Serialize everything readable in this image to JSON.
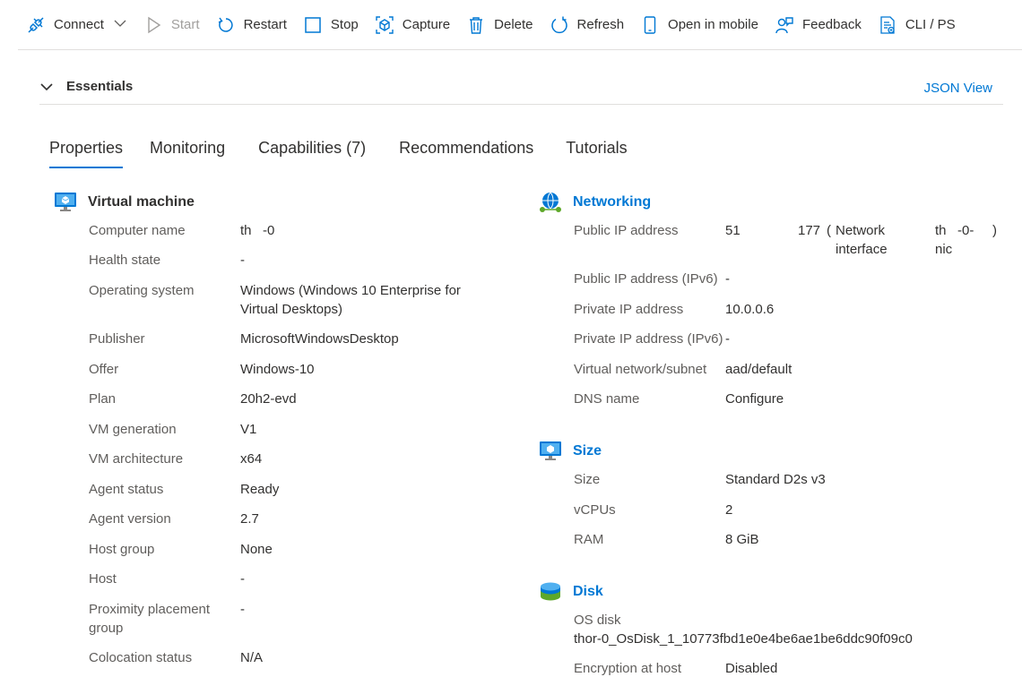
{
  "toolbar": {
    "connect": "Connect",
    "start": "Start",
    "restart": "Restart",
    "stop": "Stop",
    "capture": "Capture",
    "delete": "Delete",
    "refresh": "Refresh",
    "open_in_mobile": "Open in mobile",
    "feedback": "Feedback",
    "cli_ps": "CLI / PS"
  },
  "essentials": {
    "title": "Essentials",
    "json_view": "JSON View"
  },
  "tabs": [
    "Properties",
    "Monitoring",
    "Capabilities (7)",
    "Recommendations",
    "Tutorials"
  ],
  "virtual_machine": {
    "title": "Virtual machine",
    "rows": [
      {
        "label": "Computer name",
        "value": "th   -0"
      },
      {
        "label": "Health state",
        "value": "-"
      },
      {
        "label": "Operating system",
        "value": "Windows (Windows 10 Enterprise for",
        "value2": "Virtual Desktops)"
      },
      {
        "label": "Publisher",
        "value": "MicrosoftWindowsDesktop"
      },
      {
        "label": "Offer",
        "value": "Windows-10"
      },
      {
        "label": "Plan",
        "value": "20h2-evd"
      },
      {
        "label": "VM generation",
        "value": "V1"
      },
      {
        "label": "VM architecture",
        "value": "x64"
      },
      {
        "label": "Agent status",
        "value": "Ready"
      },
      {
        "label": "Agent version",
        "value": "2.7"
      },
      {
        "label": "Host group",
        "value": "None"
      },
      {
        "label": "Host",
        "value": "-"
      },
      {
        "label": "Proximity placement",
        "label2": "group",
        "value": "-"
      },
      {
        "label": "Colocation status",
        "value": "N/A"
      }
    ]
  },
  "networking": {
    "title": "Networking",
    "public_ip": {
      "label": "Public IP address",
      "ip_a": "51",
      "ip_b": "177",
      "paren_open": "(",
      "iface_label_1": "Network",
      "iface_label_2": "interface",
      "nic_1": "th   -0-",
      "nic_2": "nic",
      "paren_close": ")"
    },
    "rows": [
      {
        "label": "Public IP address (IPv6)",
        "value": "-"
      },
      {
        "label": "Private IP address",
        "value": "10.0.0.6"
      },
      {
        "label": "Private IP address (IPv6)",
        "value": "-"
      },
      {
        "label": "Virtual network/subnet",
        "value": "aad/default"
      },
      {
        "label": "DNS name",
        "value": "Configure"
      }
    ]
  },
  "size": {
    "title": "Size",
    "rows": [
      {
        "label": "Size",
        "value": "Standard D2s v3"
      },
      {
        "label": "vCPUs",
        "value": "2"
      },
      {
        "label": "RAM",
        "value": "8 GiB"
      }
    ]
  },
  "disk": {
    "title": "Disk",
    "os_disk_label": "OS disk",
    "os_disk_value": "thor-0_OsDisk_1_10773fbd1e0e4be6ae1be6ddc90f09c0",
    "encryption_label": "Encryption at host",
    "encryption_value": "Disabled"
  },
  "colors": {
    "accent": "#0078d4",
    "text": "#323130",
    "label": "#605e5c",
    "disabled": "#a19f9d",
    "border": "#e1dfdd"
  }
}
